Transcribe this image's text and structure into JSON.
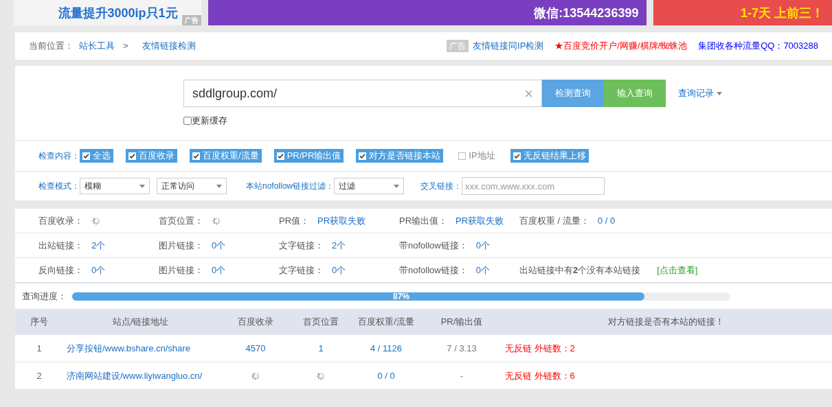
{
  "banners": [
    {
      "text": "流量提升3000ip只1元",
      "tag": "广告"
    },
    {
      "text": "微信:13544236399"
    },
    {
      "text": "1-7天 上前三！"
    }
  ],
  "breadcrumb": {
    "label": "当前位置：",
    "items": [
      "站长工具",
      "友情链接检测"
    ],
    "separator": ">"
  },
  "top_links": [
    {
      "kind": "ad",
      "tag": "广告",
      "text": "友情链接同IP检测",
      "color": "#1a6fc4"
    },
    {
      "kind": "promo",
      "text": "★百度竞价开户/网赚/棋牌/蜘蛛池",
      "color": "#ff0000"
    },
    {
      "kind": "promo",
      "text": "集团收各种流量QQ：7003288",
      "color": "#0000ff"
    }
  ],
  "search": {
    "value": "sddlgroup.com/",
    "clear": "×",
    "buttons": [
      {
        "label": "检测查询",
        "color": "#5aa5e2"
      },
      {
        "label": "输入查询",
        "color": "#6cbf5a"
      }
    ],
    "history": "查询记录",
    "refresh_cache": {
      "label": "更新缓存",
      "checked": false
    }
  },
  "options": {
    "label": "检查内容：",
    "items": [
      {
        "label": "全选",
        "checked": true
      },
      {
        "label": "百度收录",
        "checked": true
      },
      {
        "label": "百度权重/流量",
        "checked": true
      },
      {
        "label": "PR/PR输出值",
        "checked": true
      },
      {
        "label": "对方是否链接本站",
        "checked": true
      },
      {
        "label": "IP地址",
        "checked": false
      },
      {
        "label": "无反链结果上移",
        "checked": true
      }
    ]
  },
  "mode": {
    "label": "检查模式：",
    "selects": [
      "模糊",
      "正常访问"
    ],
    "nofollow_label": "本站nofollow链接过滤：",
    "nofollow_value": "过滤",
    "cross_label": "交叉链接：",
    "cross_placeholder": "xxx.com,www.xxx.com"
  },
  "stats": [
    [
      {
        "label": "百度收录：",
        "kind": "loading"
      },
      {
        "label": "首页位置：",
        "kind": "loading"
      },
      {
        "label": "PR值：",
        "kind": "text",
        "value": "PR获取失败"
      },
      {
        "label": "PR输出值：",
        "kind": "text",
        "value": "PR获取失败"
      },
      {
        "label": "百度权重 / 流量：",
        "kind": "text",
        "value": "0 / 0"
      }
    ],
    [
      {
        "label": "出站链接：",
        "kind": "text",
        "value": "2个"
      },
      {
        "label": "图片链接：",
        "kind": "text",
        "value": "0个"
      },
      {
        "label": "文字链接：",
        "kind": "text",
        "value": "2个"
      },
      {
        "label": "带nofollow链接：",
        "kind": "text",
        "value": "0个"
      }
    ],
    [
      {
        "label": "反向链接：",
        "kind": "text",
        "value": "0个"
      },
      {
        "label": "图片链接：",
        "kind": "text",
        "value": "0个"
      },
      {
        "label": "文字链接：",
        "kind": "text",
        "value": "0个"
      },
      {
        "label": "带nofollow链接：",
        "kind": "text",
        "value": "0个"
      },
      {
        "label": "出站链接中有**2**个没有本站链接",
        "kind": "note",
        "value": "[点击查看]"
      }
    ]
  ],
  "progress": {
    "label": "查询进度：",
    "level": 0.87,
    "text": "87%"
  },
  "table": {
    "columns": [
      "序号",
      "站点/链接地址",
      "百度收录",
      "首页位置",
      "百度权重/流量",
      "PR/输出值",
      "对方链接是否有本站的链接！"
    ],
    "rows": [
      {
        "no": "1",
        "site": "分享按钮/www.bshare.cn/share",
        "baidu": "4570",
        "home": "1",
        "weight": "4 / 1126",
        "pr": "7 / 3.13",
        "result": "无反链 外链数：2"
      },
      {
        "no": "2",
        "site": "济南网站建设/www.liyiwangluo.cn/",
        "baidu_loading": true,
        "home_loading": true,
        "weight": "0 / 0",
        "pr": "-",
        "result": "无反链 外链数：6"
      }
    ]
  }
}
